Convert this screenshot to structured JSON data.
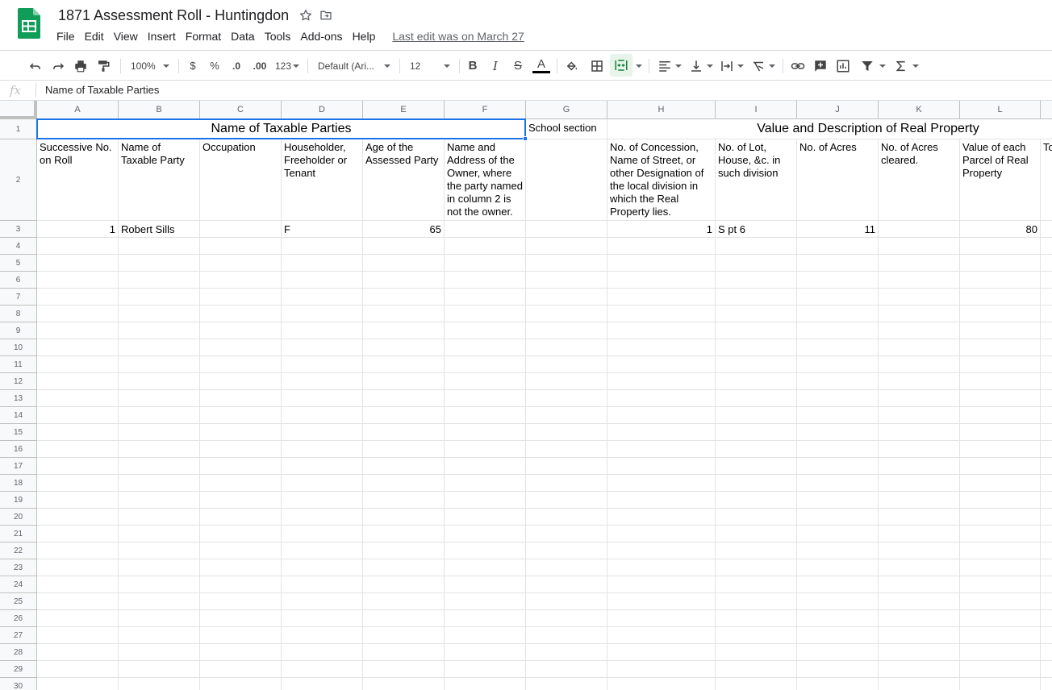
{
  "document": {
    "title": "1871 Assessment Roll - Huntingdon",
    "last_edit": "Last edit was on March 27"
  },
  "menu": [
    "File",
    "Edit",
    "View",
    "Insert",
    "Format",
    "Data",
    "Tools",
    "Add-ons",
    "Help"
  ],
  "toolbar": {
    "zoom": "100%",
    "currency": "$",
    "percent": "%",
    "decrease_decimal": ".0",
    "increase_decimal": ".00",
    "more_formats": "123",
    "font": "Default (Ari...",
    "font_size": "12",
    "bold": "B",
    "italic": "I",
    "strike": "S",
    "text_color": "A",
    "text_color_hex": "#000000",
    "merge_active_hex": "#188038"
  },
  "formula_bar": {
    "fx": "fx",
    "value": "Name of Taxable Parties"
  },
  "columns": [
    "A",
    "B",
    "C",
    "D",
    "E",
    "F",
    "G",
    "H",
    "I",
    "J",
    "K",
    "L"
  ],
  "row_numbers": [
    "1",
    "2",
    "3",
    "4",
    "5",
    "6",
    "7",
    "8",
    "9",
    "10",
    "11",
    "12",
    "13",
    "14",
    "15",
    "16",
    "17",
    "18",
    "19",
    "20",
    "21",
    "22",
    "23",
    "24",
    "25",
    "26",
    "27",
    "28",
    "29",
    "30"
  ],
  "cells": {
    "A1": "Name of Taxable Parties",
    "G1": "School section",
    "H1": "Value and Description of Real Property",
    "A2": "Successive No. on Roll",
    "B2": "Name of Taxable Party",
    "C2": "Occupation",
    "D2": "Householder, Freeholder or Tenant",
    "E2": "Age of the Assessed Party",
    "F2": "Name and Address of the Owner, where the party named in column 2 is not the owner.",
    "H2": "No. of Concession, Name of Street, or other Designation of the local division in which the Real Property lies.",
    "I2": "No. of Lot, House, &c. in such division",
    "J2": "No. of Acres",
    "K2": "No. of Acres cleared.",
    "L2": "Value of each Parcel of Real Property",
    "M2": "To R",
    "A3": "1",
    "B3": "Robert Sills",
    "D3": "F",
    "E3": "65",
    "H3": "1",
    "I3": "S pt 6",
    "J3": "11",
    "L3": "80"
  },
  "colors": {
    "selection": "#1a73e8",
    "sheets_green": "#0f9d58"
  }
}
